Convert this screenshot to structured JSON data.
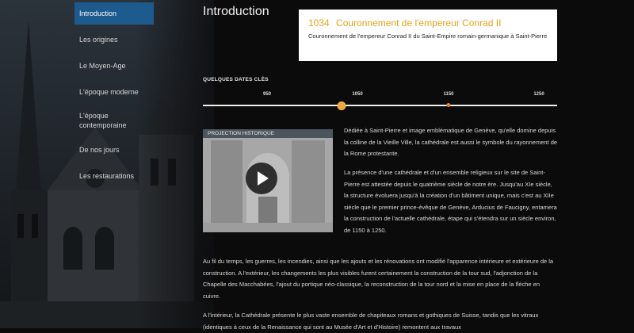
{
  "nav": {
    "items": [
      {
        "label": "Introduction"
      },
      {
        "label": "Les origines"
      },
      {
        "label": "Le Moyen-Age"
      },
      {
        "label": "L'époque moderne"
      },
      {
        "label": "L'époque contemporaine"
      },
      {
        "label": "De nos jours"
      },
      {
        "label": "Les restaurations"
      }
    ]
  },
  "page": {
    "title": "Introduction"
  },
  "event": {
    "year": "1034",
    "title": "Couronnement de l'empereur Conrad II",
    "description": "Couronnement de l'empereur Conrad II du Saint-Empire romain-germanique à Saint-Pierre"
  },
  "timeline": {
    "label": "QUELQUES DATES CLÈS",
    "ticks": [
      "950",
      "1050",
      "1150",
      "1250"
    ]
  },
  "video": {
    "caption": "PROJECTION HISTORIQUE"
  },
  "content": {
    "p1": "Dédiée à Saint-Pierre et image emblématique de Genève, qu'elle domine depuis la colline de la Vieille Ville, la cathédrale est aussi le symbole du rayonnement de la Rome protestante.",
    "p2": "La présence d'une cathédrale et d'un ensemble religieux sur le site de Saint-Pierre est attestée depuis le quatrième siècle de notre ère. Jusqu'au XIe siècle, la structure évoluera jusqu'à la création d'un bâtiment unique, mais c'est au XIIe siècle que le premier prince-évêque de Genève, Arducius de Faucigny, entamera la construction de l'actuelle cathédrale, étape qui s'étendra sur un siècle environ, de 1150 à 1250.",
    "p3": "Au fil du temps, les guerres, les incendies, ainsi que les ajouts et les rénovations ont modifié l'apparence intérieure et extérieure de la construction. A l'extérieur, les changements les plus visibles furent certainement la construction de la tour sud, l'adjonction de la Chapelle des Macchabées, l'ajout du portique néo-classique, la reconstruction de la tour nord et la mise en place de la flèche en cuivre.",
    "p4": "A l'intérieur, la Cathédrale présente le plus vaste ensemble de chapiteaux romans et gothiques de Suisse, tandis que les vitraux (identiques à ceux de la Renaissance qui sont au Musée d'Art et d'Histoire) remontent aux travaux"
  }
}
